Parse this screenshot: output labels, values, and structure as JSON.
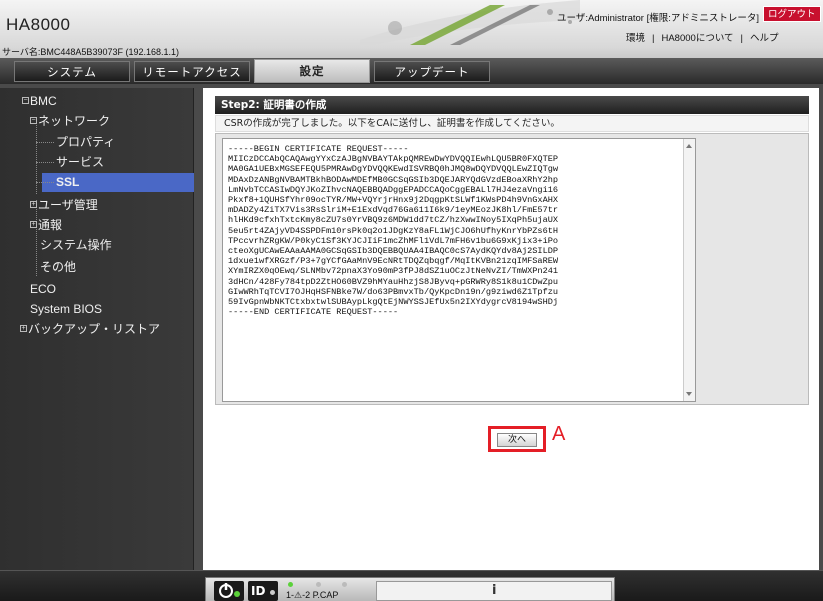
{
  "header": {
    "brand": "HA8000",
    "server_name": "サーバ名:BMC448A5B39073F (192.168.1.1)",
    "user": "ユーザ:Administrator [権限:アドミニストレータ]",
    "logout": "ログアウト",
    "links": [
      "環境",
      "HA8000について",
      "ヘルプ"
    ],
    "link_separator": "|"
  },
  "nav": {
    "tabs": [
      "システム",
      "リモートアクセス",
      "設定",
      "アップデート"
    ],
    "active": "設定"
  },
  "sidebar": {
    "items": [
      {
        "label": "BMC",
        "expander": "⊟"
      },
      {
        "label": "ネットワーク",
        "expander": "⊟"
      },
      {
        "label": "プロパティ"
      },
      {
        "label": "サービス"
      },
      {
        "label": "SSL",
        "selected": true
      },
      {
        "label": "ユーザ管理",
        "expander": "⊞"
      },
      {
        "label": "通報",
        "expander": "⊞"
      },
      {
        "label": "システム操作"
      },
      {
        "label": "その他"
      },
      {
        "label": "ECO"
      },
      {
        "label": "System BIOS"
      },
      {
        "label": "バックアップ・リストア",
        "expander": "⊞"
      }
    ]
  },
  "content": {
    "step_title": "Step2: 証明書の作成",
    "description": "CSRの作成が完了しました。以下をCAに送付し、証明書を作成してください。",
    "csr_lines": [
      "-----BEGIN CERTIFICATE REQUEST-----",
      "MIICzDCCAbQCAQAwgYYxCzAJBgNVBAYTAkpQMREwDwYDVQQIEwhLQU5BR0FXQTEP",
      "MA0GA1UEBxMGSEFEQU5PMRAwDgYDVQQKEwdISVRBQ0hJMQ8wDQYDVQQLEwZIQTgw",
      "MDAxDzANBgNVBAMTBkhBODAwMDEfMB0GCSqGSIb3DQEJARYQdGVzdEBoaXRhY2hp",
      "LmNvbTCCASIwDQYJKoZIhvcNAQEBBQADggEPADCCAQoCggEBALl7HJ4ezaVngi16",
      "Pkxf8+1QUHSfYhr09ocTYR/MW+VQYrjrHnx9j2DqgpKtSLWf1KWsPD4h9VnGxAHX",
      "mDADZy4ZiTX7Vis3RsSlriM+E1ExdVqd76Ga611I6k9/1eyMEozJK8hl/FmE57tr",
      "hlHKd9cfxhTxtcKmy8cZU7s0YrVBQ9z6MDW1dd7tCZ/hzXwwINoy5IXqPh5ujaUX",
      "5eu5rt4ZAjyVD4SSPDFm10rsPk0q2o1JDgKzY8aFL1WjCJO6hUfhyKnrYbPZs6tH",
      "TPccvrhZRgKW/P0kyC1Sf3KYJCJIiF1mcZhMFl1VdL7mFH6v1bu6G9xKjix3+iPo",
      "cteoXgUCAwEAAaAAMA0GCSqGSIb3DQEBBQUAA4IBAQC0cS7AydKQYdv8Aj2SILDP",
      "1dxue1wfXRGzf/P3+7gYCfGAaMnV9EcNRtTDQZqbqgf/MqItKVBn21zqIMFSaREW",
      "XYmIRZX0qOEwq/SLNMbv72pnaX3Yo90mP3fPJ8dSZ1uOCzJtNeNvZI/TmWXPn241",
      "3dHCn/428Fy784tpD2ZtHO60BVZ9hMYauHhzjS8JByvq+pGRWRy8S1k8u1CDwZpu",
      "GIwWRhTqTCVI7OJHqHSFNBke7W/do63PBmvxTb/QyKpcDn19n/g9ziwd6Z1Tpfzu",
      "59IvGpnWbNKTCtxbxtwlSUBAypLkgQtEjNWYSSJEfUx5n2IXYdygrcV8194wSHDj",
      "-----END CERTIFICATE REQUEST-----"
    ],
    "next_button": "次へ",
    "annotation": "A"
  },
  "footer": {
    "id_label": "ID",
    "led_labels": "1-⚠-2 P.CAP",
    "info_icon": "i"
  },
  "colors": {
    "accent_red": "#e41e26",
    "selected_blue": "#4a68c6",
    "logout_red": "#c8102e"
  }
}
